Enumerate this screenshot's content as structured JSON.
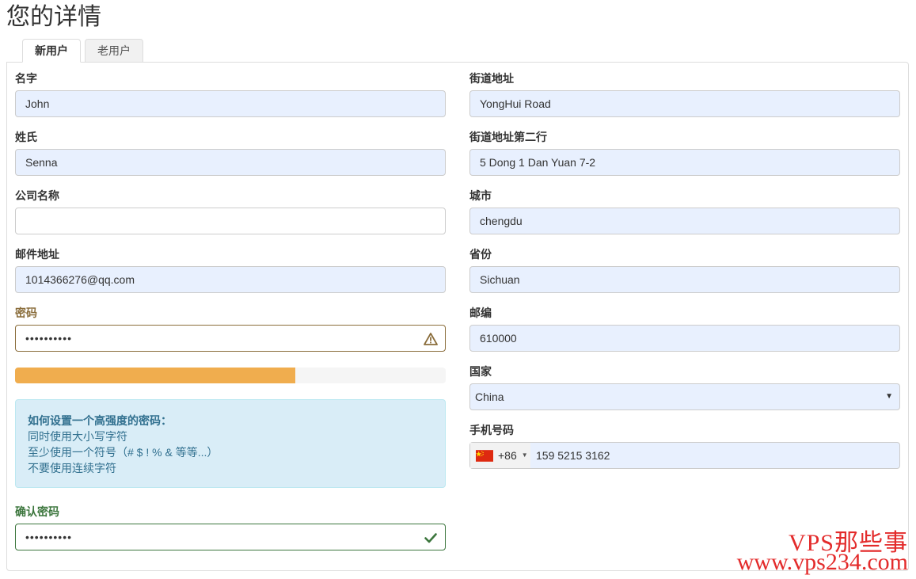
{
  "page": {
    "title": "您的详情"
  },
  "tabs": [
    {
      "label": "新用户",
      "active": true
    },
    {
      "label": "老用户",
      "active": false
    }
  ],
  "left": {
    "first_name": {
      "label": "名字",
      "value": "John"
    },
    "last_name": {
      "label": "姓氏",
      "value": "Senna"
    },
    "company": {
      "label": "公司名称",
      "value": ""
    },
    "email": {
      "label": "邮件地址",
      "value": "1014366276@qq.com"
    },
    "password": {
      "label": "密码",
      "value": "••••••••••",
      "state": "warning"
    },
    "strength": {
      "fraction": 0.65,
      "color": "#f0ad4e"
    },
    "tips": {
      "title": "如何设置一个高强度的密码：",
      "lines": [
        "同时使用大小写字符",
        "至少使用一个符号（# $ ! % & 等等...）",
        "不要使用连续字符"
      ]
    },
    "confirm_password": {
      "label": "确认密码",
      "value": "••••••••••",
      "state": "ok"
    }
  },
  "right": {
    "address1": {
      "label": "街道地址",
      "value": "YongHui Road"
    },
    "address2": {
      "label": "街道地址第二行",
      "value": "5 Dong 1 Dan Yuan 7-2"
    },
    "city": {
      "label": "城市",
      "value": "chengdu"
    },
    "state": {
      "label": "省份",
      "value": "Sichuan"
    },
    "postcode": {
      "label": "邮编",
      "value": "610000"
    },
    "country": {
      "label": "国家",
      "value": "China"
    },
    "phone": {
      "label": "手机号码",
      "code": "+86",
      "number": "159 5215 3162",
      "flag": "china-flag"
    }
  },
  "watermark": {
    "line1": "VPS那些事",
    "line2": "www.vps234.com"
  },
  "colors": {
    "autofill": "#e8f0fe",
    "warning": "#8a6d3b",
    "success": "#3c763d",
    "info_bg": "#d9edf7",
    "info_text": "#31708f"
  }
}
